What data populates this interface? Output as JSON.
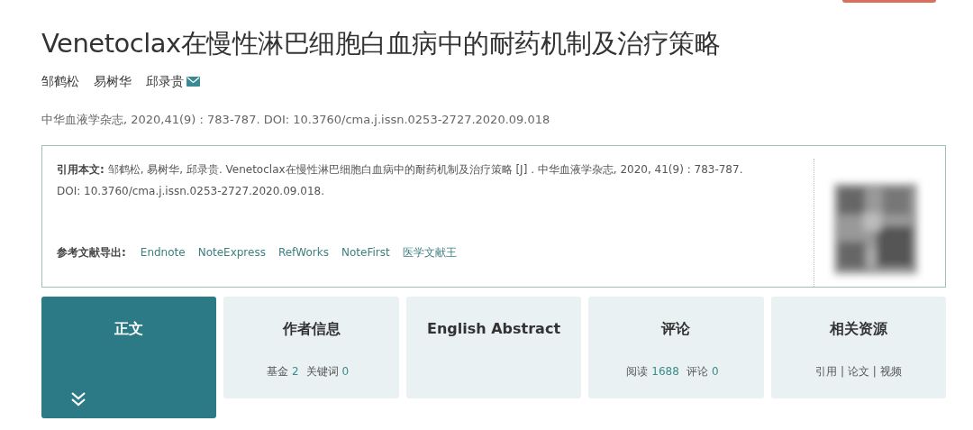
{
  "title": "Venetoclax在慢性淋巴细胞白血病中的耐药机制及治疗策略",
  "authors": [
    {
      "name": "邹鹤松",
      "email": false
    },
    {
      "name": "易树华",
      "email": false
    },
    {
      "name": "邱录贵",
      "email": true
    }
  ],
  "journal_line": "中华血液学杂志, 2020,41(9) : 783-787. DOI: 10.3760/cma.j.issn.0253-2727.2020.09.018",
  "citation": {
    "text": "**引用本文:** 邹鹤松, 易树华, 邱录贵. Venetoclax在慢性淋巴细胞白血病中的耐药机制及治疗策略 [J] . 中华血液学杂志, 2020, 41(9) : 783-787. DOI: 10.3760/cma.j.issn.0253-2727.2020.09.018.",
    "export_label": "参考文献导出:",
    "export_links": [
      "Endnote",
      "NoteExpress",
      "RefWorks",
      "NoteFirst",
      "医学文献王"
    ]
  },
  "tabs": [
    {
      "label": "正文",
      "selected": true
    },
    {
      "label": "作者信息",
      "selected": false,
      "meta": [
        {
          "text": "基金",
          "kind": "label"
        },
        {
          "text": "2",
          "kind": "count"
        },
        {
          "text": "关键词",
          "kind": "label"
        },
        {
          "text": "0",
          "kind": "count"
        }
      ]
    },
    {
      "label": "English Abstract",
      "selected": false
    },
    {
      "label": "评论",
      "selected": false,
      "meta": [
        {
          "text": "阅读",
          "kind": "label"
        },
        {
          "text": "1688",
          "kind": "count"
        },
        {
          "text": "评论",
          "kind": "label"
        },
        {
          "text": "0",
          "kind": "count"
        }
      ]
    },
    {
      "label": "相关资源",
      "selected": false,
      "meta": [
        {
          "text": "引用 | 论文 | 视频",
          "kind": "label"
        }
      ]
    }
  ]
}
